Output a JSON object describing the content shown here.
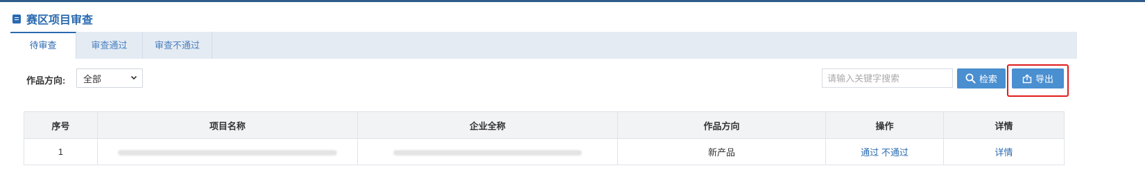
{
  "page": {
    "title": "赛区项目审查"
  },
  "tabs": [
    {
      "label": "待审查",
      "active": true
    },
    {
      "label": "审查通过",
      "active": false
    },
    {
      "label": "审查不通过",
      "active": false
    }
  ],
  "filter": {
    "label": "作品方向:",
    "selected": "全部"
  },
  "search": {
    "placeholder": "请输入关键字搜索",
    "search_label": "检索",
    "export_label": "导出"
  },
  "table": {
    "headers": [
      "序号",
      "项目名称",
      "企业全称",
      "作品方向",
      "操作",
      "详情"
    ],
    "rows": [
      {
        "index": "1",
        "project_name": "",
        "company_name": "",
        "direction": "新产品",
        "action_approve": "通过",
        "action_reject": "不通过",
        "details": "详情"
      }
    ]
  },
  "colors": {
    "accent": "#2a6ab0",
    "button": "#4a8fd0",
    "highlight_border": "#e21b1b",
    "tab_bar": "#e4ebf3"
  },
  "icons": {
    "title": "document-icon",
    "select": "chevron-down-icon",
    "search_button": "search-icon",
    "export_button": "export-icon"
  }
}
